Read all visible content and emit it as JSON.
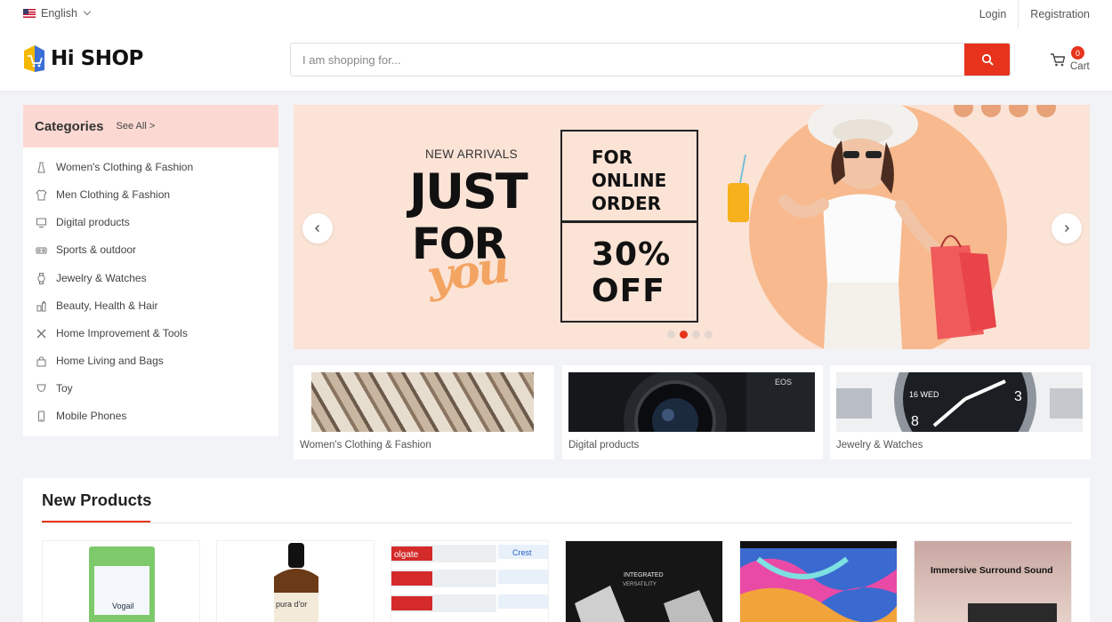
{
  "topbar": {
    "language": "English",
    "login": "Login",
    "registration": "Registration"
  },
  "header": {
    "logo": "Hi SHOP",
    "search_placeholder": "I am shopping for...",
    "cart_count": "0",
    "cart_label": "Cart"
  },
  "categories": {
    "title": "Categories",
    "see_all": "See All >",
    "items": [
      {
        "label": "Women's Clothing & Fashion",
        "icon": "dress-icon"
      },
      {
        "label": "Men Clothing & Fashion",
        "icon": "shirt-icon"
      },
      {
        "label": "Digital products",
        "icon": "monitor-icon"
      },
      {
        "label": "Sports & outdoor",
        "icon": "sports-icon"
      },
      {
        "label": "Jewelry & Watches",
        "icon": "watch-icon"
      },
      {
        "label": "Beauty, Health & Hair",
        "icon": "beauty-icon"
      },
      {
        "label": "Home Improvement & Tools",
        "icon": "tools-icon"
      },
      {
        "label": "Home Living and Bags",
        "icon": "bag-icon"
      },
      {
        "label": "Toy",
        "icon": "toy-icon"
      },
      {
        "label": "Mobile Phones",
        "icon": "phone-icon"
      }
    ]
  },
  "banner": {
    "new_arrivals": "NEW ARRIVALS",
    "just": "JUST",
    "for": "FOR",
    "you": "you",
    "box_top": [
      "FOR",
      "ONLINE",
      "ORDER"
    ],
    "box_bottom": [
      "30%",
      "OFF"
    ],
    "active_slide": 2,
    "slide_count": 4
  },
  "promo_tiles": [
    {
      "label": "Women's Clothing & Fashion"
    },
    {
      "label": "Digital products"
    },
    {
      "label": "Jewelry & Watches"
    }
  ],
  "new_products": {
    "title": "New Products",
    "items": [
      {
        "image_text": [
          "Vogail"
        ]
      },
      {
        "image_text": [
          "pura d'or"
        ]
      },
      {
        "image_text": [
          "olgate",
          "Crest"
        ]
      },
      {
        "image_text": [
          "INTEGRATED",
          "VERSATILITY"
        ]
      },
      {
        "image_text": []
      },
      {
        "image_text": [
          "Immersive Surround Sound"
        ]
      }
    ]
  },
  "colors": {
    "accent": "#e8331c",
    "category_header_bg": "#fbd9d2",
    "banner_bg": "#fbe3d6"
  }
}
